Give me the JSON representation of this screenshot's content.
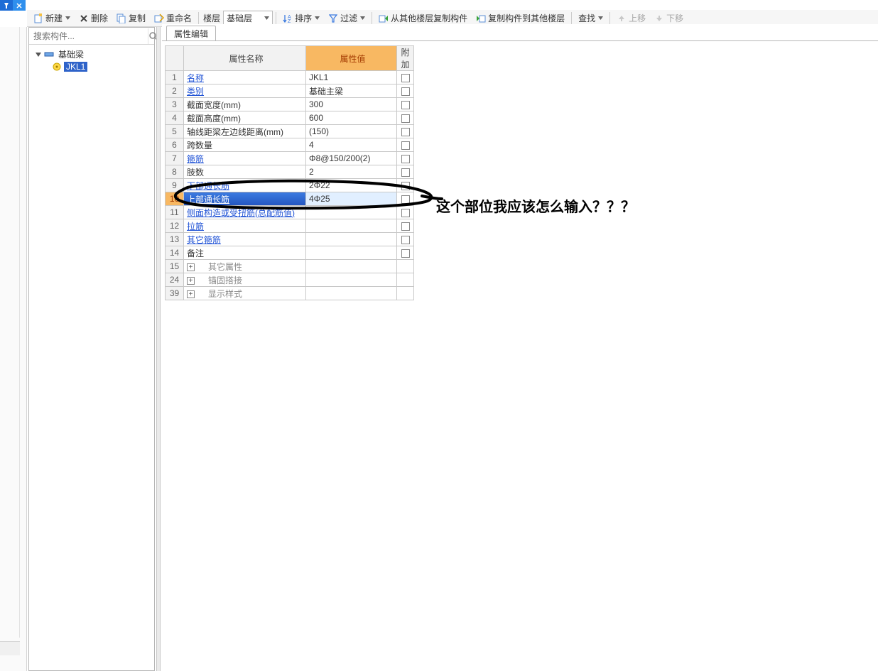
{
  "toolbar": {
    "new": "新建",
    "delete": "删除",
    "copy": "复制",
    "rename": "重命名",
    "floor_label": "楼层",
    "floor_value": "基础层",
    "sort": "排序",
    "filter": "过滤",
    "copy_from": "从其他楼层复制构件",
    "copy_to": "复制构件到其他楼层",
    "find": "查找",
    "move_up": "上移",
    "move_down": "下移"
  },
  "search": {
    "placeholder": "搜索构件..."
  },
  "tree": {
    "root": "基础梁",
    "child": "JKL1"
  },
  "prop": {
    "tab": "属性编辑",
    "head_name": "属性名称",
    "head_value": "属性值",
    "head_add": "附加",
    "rows": [
      {
        "n": "1",
        "name": "名称",
        "name_link": true,
        "val": "JKL1",
        "chk": false,
        "exp": null
      },
      {
        "n": "2",
        "name": "类别",
        "name_link": true,
        "val": "基础主梁",
        "chk": true,
        "exp": null
      },
      {
        "n": "3",
        "name": "截面宽度(mm)",
        "name_link": false,
        "val": "300",
        "chk": true,
        "exp": null
      },
      {
        "n": "4",
        "name": "截面高度(mm)",
        "name_link": false,
        "val": "600",
        "chk": true,
        "exp": null
      },
      {
        "n": "5",
        "name": "轴线距梁左边线距离(mm)",
        "name_link": false,
        "val": "(150)",
        "chk": true,
        "exp": null
      },
      {
        "n": "6",
        "name": "跨数量",
        "name_link": false,
        "val": "4",
        "chk": true,
        "exp": null
      },
      {
        "n": "7",
        "name": "箍筋",
        "name_link": true,
        "val": "Φ8@150/200(2)",
        "chk": true,
        "exp": null
      },
      {
        "n": "8",
        "name": "肢数",
        "name_link": false,
        "val": "2",
        "chk": false,
        "exp": null
      },
      {
        "n": "9",
        "name": "下部通长筋",
        "name_link": true,
        "val": "2Φ22",
        "chk": true,
        "exp": null
      },
      {
        "n": "10",
        "name": "上部通长筋",
        "name_link": true,
        "val": "4Φ25",
        "chk": true,
        "exp": null,
        "selected": true
      },
      {
        "n": "11",
        "name": "侧面构造或受扭筋(总配筋值)",
        "name_link": true,
        "val": "",
        "chk": true,
        "exp": null
      },
      {
        "n": "12",
        "name": "拉筋",
        "name_link": true,
        "val": "",
        "chk": true,
        "exp": null
      },
      {
        "n": "13",
        "name": "其它箍筋",
        "name_link": true,
        "val": "",
        "chk": false,
        "exp": null
      },
      {
        "n": "14",
        "name": "备注",
        "name_link": false,
        "val": "",
        "chk": true,
        "exp": null
      },
      {
        "n": "15",
        "name": "其它属性",
        "name_link": false,
        "val": "",
        "chk": false,
        "exp": "+",
        "gray": true
      },
      {
        "n": "24",
        "name": "锚固搭接",
        "name_link": false,
        "val": "",
        "chk": false,
        "exp": "+",
        "gray": true
      },
      {
        "n": "39",
        "name": "显示样式",
        "name_link": false,
        "val": "",
        "chk": false,
        "exp": "+",
        "gray": true
      }
    ]
  },
  "annotation": "这个部位我应该怎么输入？？？"
}
